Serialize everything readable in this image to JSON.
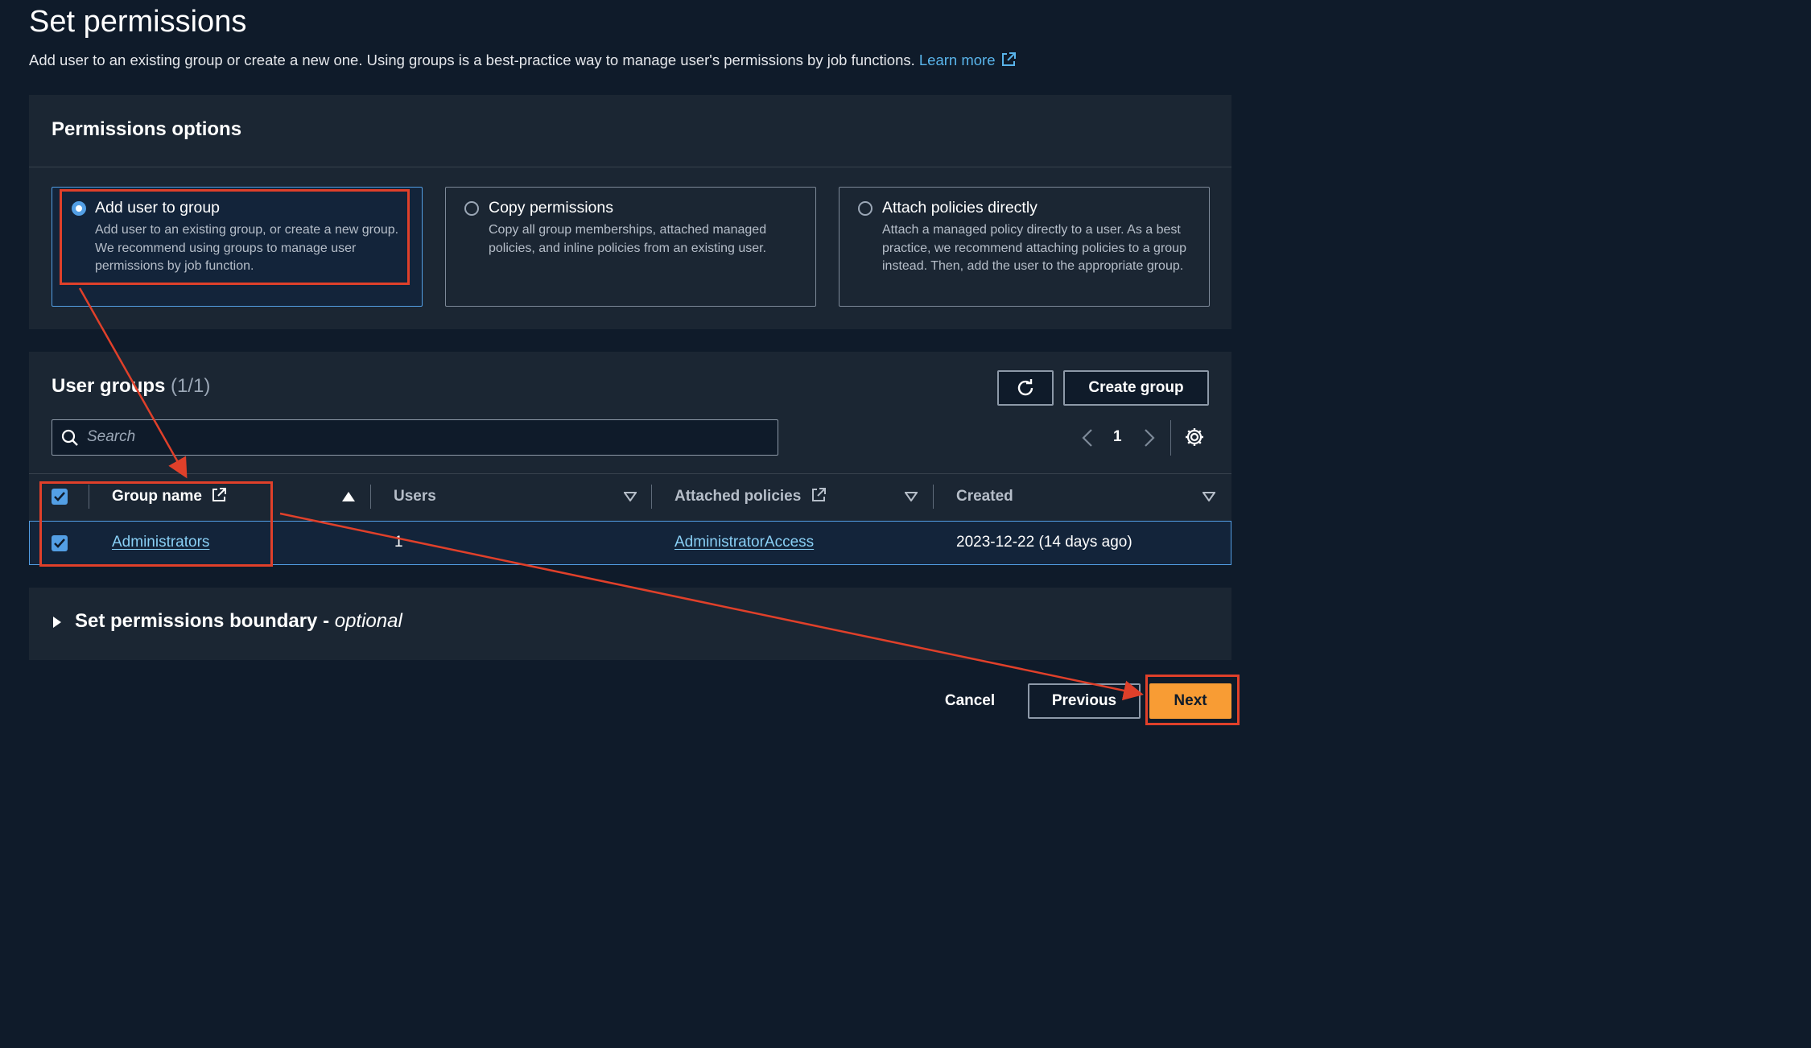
{
  "page": {
    "title": "Set permissions",
    "description": "Add user to an existing group or create a new one. Using groups is a best-practice way to manage user's permissions by job functions.",
    "learn_more": "Learn more"
  },
  "permissions": {
    "heading": "Permissions options",
    "options": [
      {
        "title": "Add user to group",
        "description": "Add user to an existing group, or create a new group. We recommend using groups to manage user permissions by job function.",
        "selected": true
      },
      {
        "title": "Copy permissions",
        "description": "Copy all group memberships, attached managed policies, and inline policies from an existing user.",
        "selected": false
      },
      {
        "title": "Attach policies directly",
        "description": "Attach a managed policy directly to a user. As a best practice, we recommend attaching policies to a group instead. Then, add the user to the appropriate group.",
        "selected": false
      }
    ]
  },
  "groups": {
    "heading": "User groups",
    "count": "(1/1)",
    "create_group": "Create group",
    "refresh_icon": "refresh-icon",
    "search_placeholder": "Search",
    "page_number": "1",
    "columns": [
      "Group name",
      "Users",
      "Attached policies",
      "Created"
    ],
    "rows": [
      {
        "group_name": "Administrators",
        "users": "1",
        "attached_policies": "AdministratorAccess",
        "created": "2023-12-22 (14 days ago)",
        "checked": true
      }
    ]
  },
  "boundary": {
    "title": "Set permissions boundary - ",
    "optional": "optional"
  },
  "footer": {
    "cancel": "Cancel",
    "previous": "Previous",
    "next": "Next"
  },
  "colors": {
    "background": "#0f1b2a",
    "panel": "#1b2633",
    "accent_blue": "#539fe5",
    "link": "#59b4ea",
    "primary_button": "#f89c34",
    "annotation_red": "#e0402a"
  }
}
